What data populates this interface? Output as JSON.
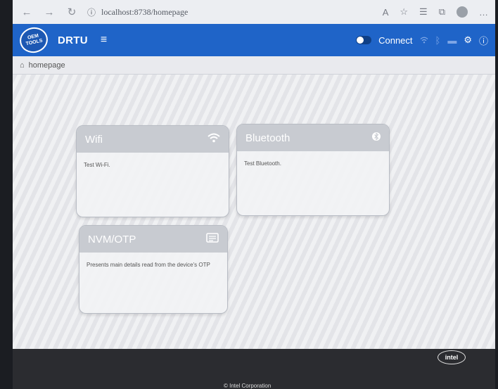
{
  "browser": {
    "url": "localhost:8738/homepage",
    "icons": [
      "back-icon",
      "forward-icon",
      "refresh-icon",
      "info-icon",
      "read-aloud-icon",
      "favorite-icon",
      "favorites-list-icon",
      "collections-icon",
      "profile-icon",
      "more-icon"
    ]
  },
  "header": {
    "logo_line1": "OEM",
    "logo_line2": "TOOLS",
    "title": "DRTU",
    "menu_glyph": "≡",
    "connect_label": "Connect"
  },
  "breadcrumb": {
    "label": "homepage"
  },
  "cards": [
    {
      "title": "Wifi",
      "description": "Test Wi-Fi.",
      "icon": "wifi-icon"
    },
    {
      "title": "Bluetooth",
      "description": "Test Bluetooth.",
      "icon": "bluetooth-icon"
    },
    {
      "title": "NVM/OTP",
      "description": "Presents main details read from the device's OTP",
      "icon": "memory-icon"
    }
  ],
  "footer": {
    "logo": "intel",
    "copyright": "© Intel Corporation"
  },
  "colors": {
    "header": "#1f64c8",
    "card_header": "#c8cbd1",
    "footer": "#2b2c30"
  }
}
